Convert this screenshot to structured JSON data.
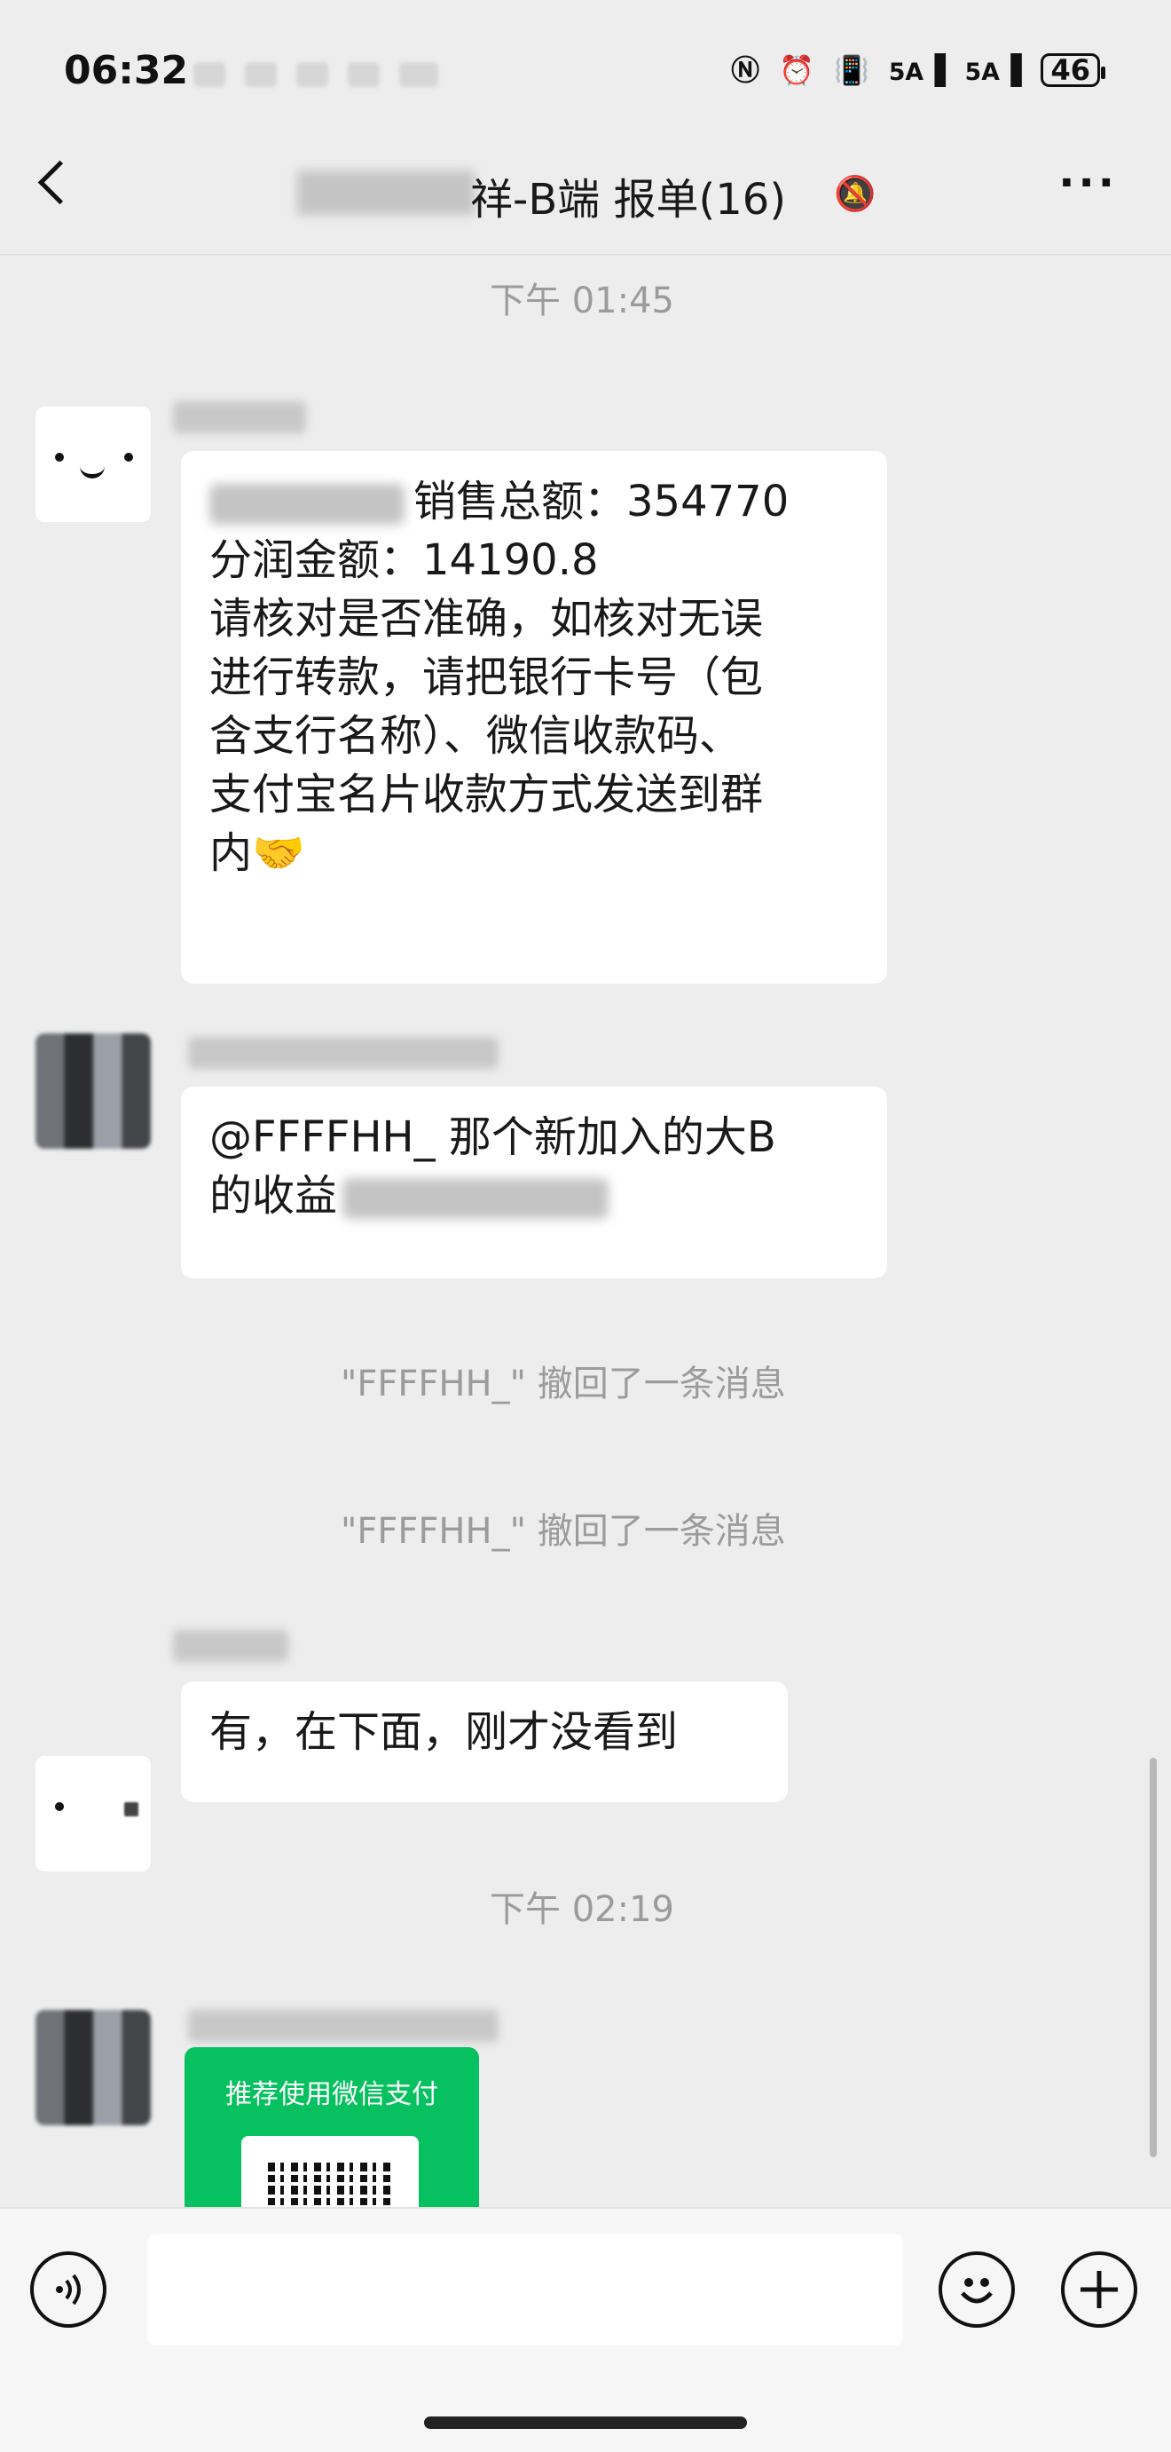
{
  "status_bar": {
    "time": "06:32",
    "signal1": "5A",
    "signal2": "5A",
    "battery": "46"
  },
  "nav": {
    "title_suffix": "祥-B端 报单(16)"
  },
  "messages": {
    "time1": "下午 01:45",
    "msg1": {
      "line1_text": "销售总额：354770",
      "line2": "分润金额：14190.8",
      "line3": "请核对是否准确，如核对无误",
      "line4": "进行转款，请把银行卡号（包",
      "line5": "含支行名称）、微信收款码、",
      "line6": "支付宝名片收款方式发送到群",
      "line7": "内🤝"
    },
    "msg2": {
      "line1": "@FFFFHH_ 那个新加入的大B",
      "line2_text": "的收益"
    },
    "recall1": "\"FFFFHH_\" 撤回了一条消息",
    "recall2": "\"FFFFHH_\" 撤回了一条消息",
    "msg3": "有，在下面，刚才没看到",
    "time2": "下午 02:19",
    "pay_card_title": "推荐使用微信支付"
  },
  "icons": {
    "back": "back-icon",
    "mute": "mute-bell-icon",
    "more": "more-icon",
    "voice": "voice-icon",
    "emoji": "emoji-icon",
    "plus": "plus-icon"
  }
}
